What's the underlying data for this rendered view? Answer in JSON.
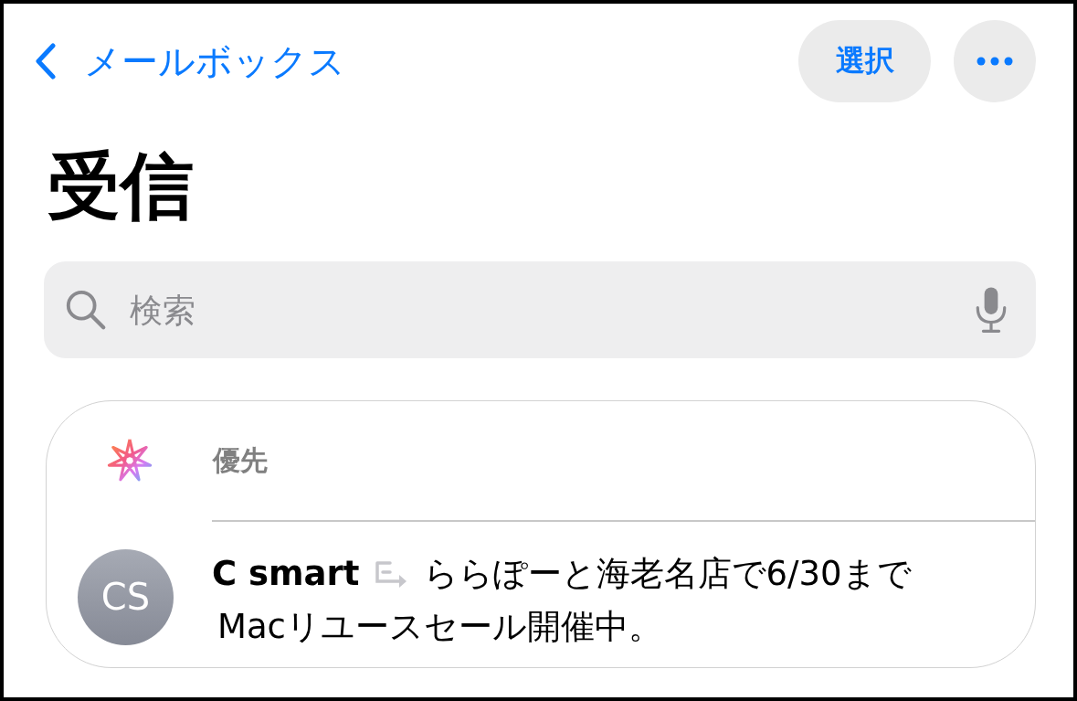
{
  "nav": {
    "back_label": "メールボックス",
    "select_label": "選択"
  },
  "title": "受信",
  "search": {
    "placeholder": "検索"
  },
  "priority": {
    "label": "優先"
  },
  "messages": [
    {
      "initials": "CS",
      "sender": "C smart",
      "forwarded": true,
      "preview_lines": [
        "ららぽーと海老名店で6/30まで",
        "Macリユースセール開催中。"
      ]
    }
  ]
}
